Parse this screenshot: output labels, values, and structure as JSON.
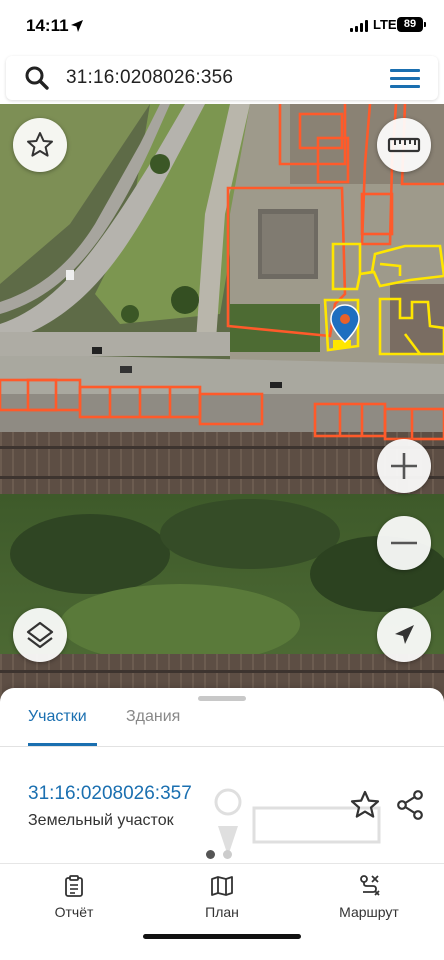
{
  "status_bar": {
    "time": "14:11",
    "network": "LTE",
    "battery": "89"
  },
  "search": {
    "query": "31:16:0208026:356"
  },
  "map": {
    "parcel_outline_color": "#ff5a2a",
    "selected_outline_color": "#ffe600",
    "marker_color": "#1e6fc0",
    "buttons": [
      "star-icon",
      "ruler-icon",
      "zoom-in-icon",
      "zoom-out-icon",
      "layers-icon",
      "navigation-arrow-icon"
    ]
  },
  "sheet": {
    "tabs": [
      "Участки",
      "Здания"
    ],
    "active_tab": "Участки",
    "parcel": {
      "number": "31:16:0208026:357",
      "type": "Земельный участок"
    },
    "pagination": {
      "current": 1,
      "total": 2
    }
  },
  "bottom_nav": [
    {
      "label": "Отчёт",
      "icon": "clipboard-icon"
    },
    {
      "label": "План",
      "icon": "map-icon"
    },
    {
      "label": "Маршрут",
      "icon": "route-icon"
    }
  ],
  "colors": {
    "accent": "#1a6fb0"
  }
}
